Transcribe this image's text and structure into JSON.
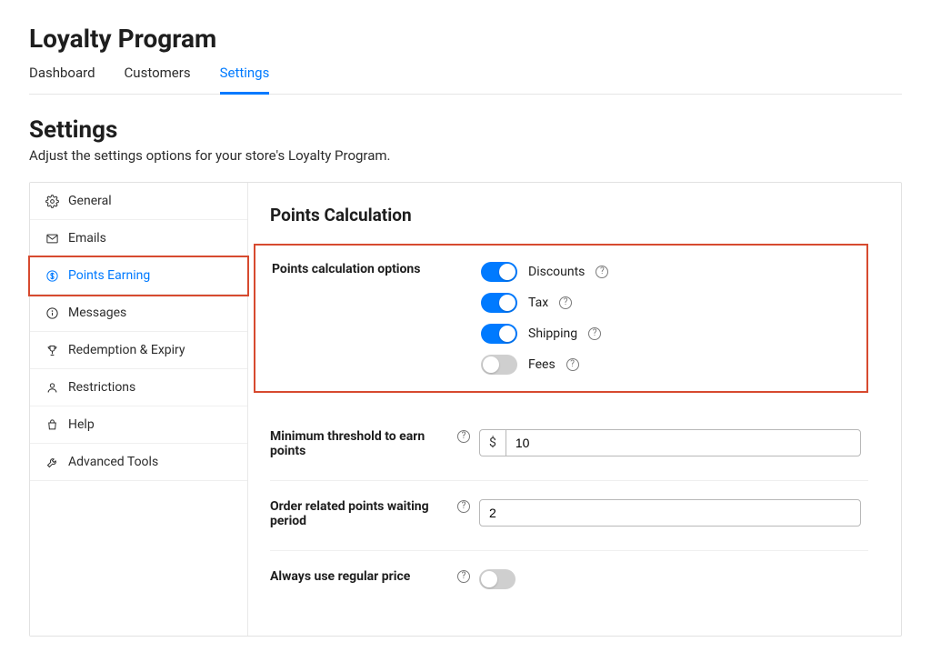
{
  "header": {
    "title": "Loyalty Program",
    "tabs": [
      {
        "label": "Dashboard"
      },
      {
        "label": "Customers"
      },
      {
        "label": "Settings"
      }
    ],
    "active_tab": 2
  },
  "section": {
    "title": "Settings",
    "subtitle": "Adjust the settings options for your store's Loyalty Program."
  },
  "sidebar": {
    "items": [
      {
        "label": "General",
        "icon": "gear-icon"
      },
      {
        "label": "Emails",
        "icon": "mail-icon"
      },
      {
        "label": "Points Earning",
        "icon": "dollar-circle-icon"
      },
      {
        "label": "Messages",
        "icon": "info-icon"
      },
      {
        "label": "Redemption & Expiry",
        "icon": "trophy-icon"
      },
      {
        "label": "Restrictions",
        "icon": "person-icon"
      },
      {
        "label": "Help",
        "icon": "bag-icon"
      },
      {
        "label": "Advanced Tools",
        "icon": "wrench-icon"
      }
    ],
    "active_index": 2
  },
  "panel": {
    "title": "Points Calculation",
    "calc_options": {
      "label": "Points calculation options",
      "toggles": [
        {
          "label": "Discounts",
          "on": true
        },
        {
          "label": "Tax",
          "on": true
        },
        {
          "label": "Shipping",
          "on": true
        },
        {
          "label": "Fees",
          "on": false
        }
      ]
    },
    "min_threshold": {
      "label": "Minimum threshold to earn points",
      "prefix": "$",
      "value": "10"
    },
    "waiting_period": {
      "label": "Order related points waiting period",
      "value": "2"
    },
    "regular_price": {
      "label": "Always use regular price",
      "on": false
    }
  }
}
